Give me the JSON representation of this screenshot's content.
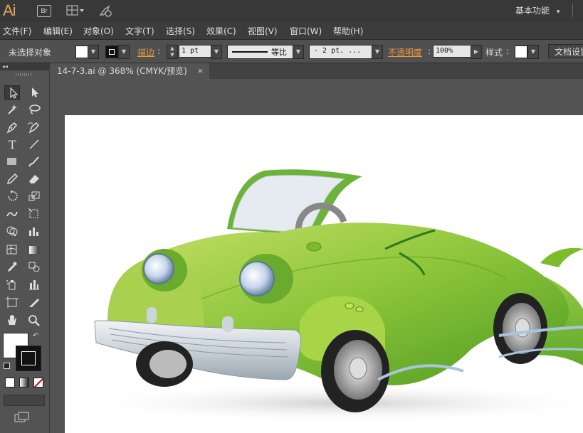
{
  "app": {
    "logo": "Ai",
    "bridge_label": "Br",
    "workspace_label": "基本功能"
  },
  "menu": [
    "文件(F)",
    "编辑(E)",
    "对象(O)",
    "文字(T)",
    "选择(S)",
    "效果(C)",
    "视图(V)",
    "窗口(W)",
    "帮助(H)"
  ],
  "control": {
    "selection_status": "未选择对象",
    "stroke_label": "描边",
    "stroke_value": "1 pt",
    "profile_label": "等比",
    "brush_value": "· 2 pt. ...",
    "opacity_label": "不透明度",
    "opacity_value": "100%",
    "style_label": "样式",
    "doc_setup_label": "文档设置"
  },
  "tab": {
    "title": "14-7-3.ai @ 368% (CMYK/预览)",
    "close": "×"
  },
  "colors": {
    "accent": "#e89a3c",
    "car_green": "#7cbb2b",
    "car_dark_green": "#3f8f1c"
  },
  "tools": [
    "selection-tool",
    "direct-selection-tool",
    "magic-wand-tool",
    "lasso-tool",
    "pen-tool",
    "curvature-tool",
    "type-tool",
    "line-tool",
    "rectangle-tool",
    "paintbrush-tool",
    "pencil-tool",
    "eraser-tool",
    "rotate-tool",
    "scale-tool",
    "warp-tool",
    "free-transform-tool",
    "shape-builder-tool",
    "graph-tool",
    "mesh-tool",
    "gradient-tool",
    "eyedropper-tool",
    "blend-tool",
    "symbol-sprayer-tool",
    "column-graph-tool",
    "artboard-tool",
    "slice-tool",
    "hand-tool",
    "zoom-tool"
  ]
}
